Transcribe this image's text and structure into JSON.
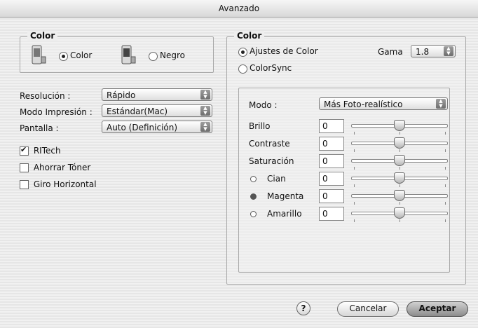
{
  "window": {
    "title": "Avanzado"
  },
  "left": {
    "color_group": {
      "title": "Color",
      "option_color": "Color",
      "option_black": "Negro",
      "selected": "Color"
    },
    "settings": [
      {
        "label": "Resolución :",
        "value": "Rápido"
      },
      {
        "label": "Modo Impresión :",
        "value": "Estándar(Mac)"
      },
      {
        "label": "Pantalla :",
        "value": "Auto (Definición)"
      }
    ],
    "checkboxes": [
      {
        "label": "RITech",
        "checked": true
      },
      {
        "label": "Ahorrar Tóner",
        "checked": false
      },
      {
        "label": "Giro Horizontal",
        "checked": false
      }
    ]
  },
  "right": {
    "title": "Color",
    "option_adjust": "Ajustes de Color",
    "option_colorsync": "ColorSync",
    "gamma_label": "Gama",
    "gamma_value": "1.8",
    "mode_label": "Modo :",
    "mode_value": "Más Foto-realístico",
    "adjustments": [
      {
        "label": "Brillo",
        "value": "0",
        "level": 0.5
      },
      {
        "label": "Contraste",
        "value": "0",
        "level": 0.5
      },
      {
        "label": "Saturación",
        "value": "0",
        "level": 0.5
      },
      {
        "label": "Cian",
        "value": "0",
        "level": 0.5,
        "dot": "#ffffff"
      },
      {
        "label": "Magenta",
        "value": "0",
        "level": 0.5,
        "dot": "#555555"
      },
      {
        "label": "Amarillo",
        "value": "0",
        "level": 0.5,
        "dot": "#ffffff"
      }
    ]
  },
  "footer": {
    "help": "?",
    "cancel": "Cancelar",
    "accept": "Aceptar"
  }
}
